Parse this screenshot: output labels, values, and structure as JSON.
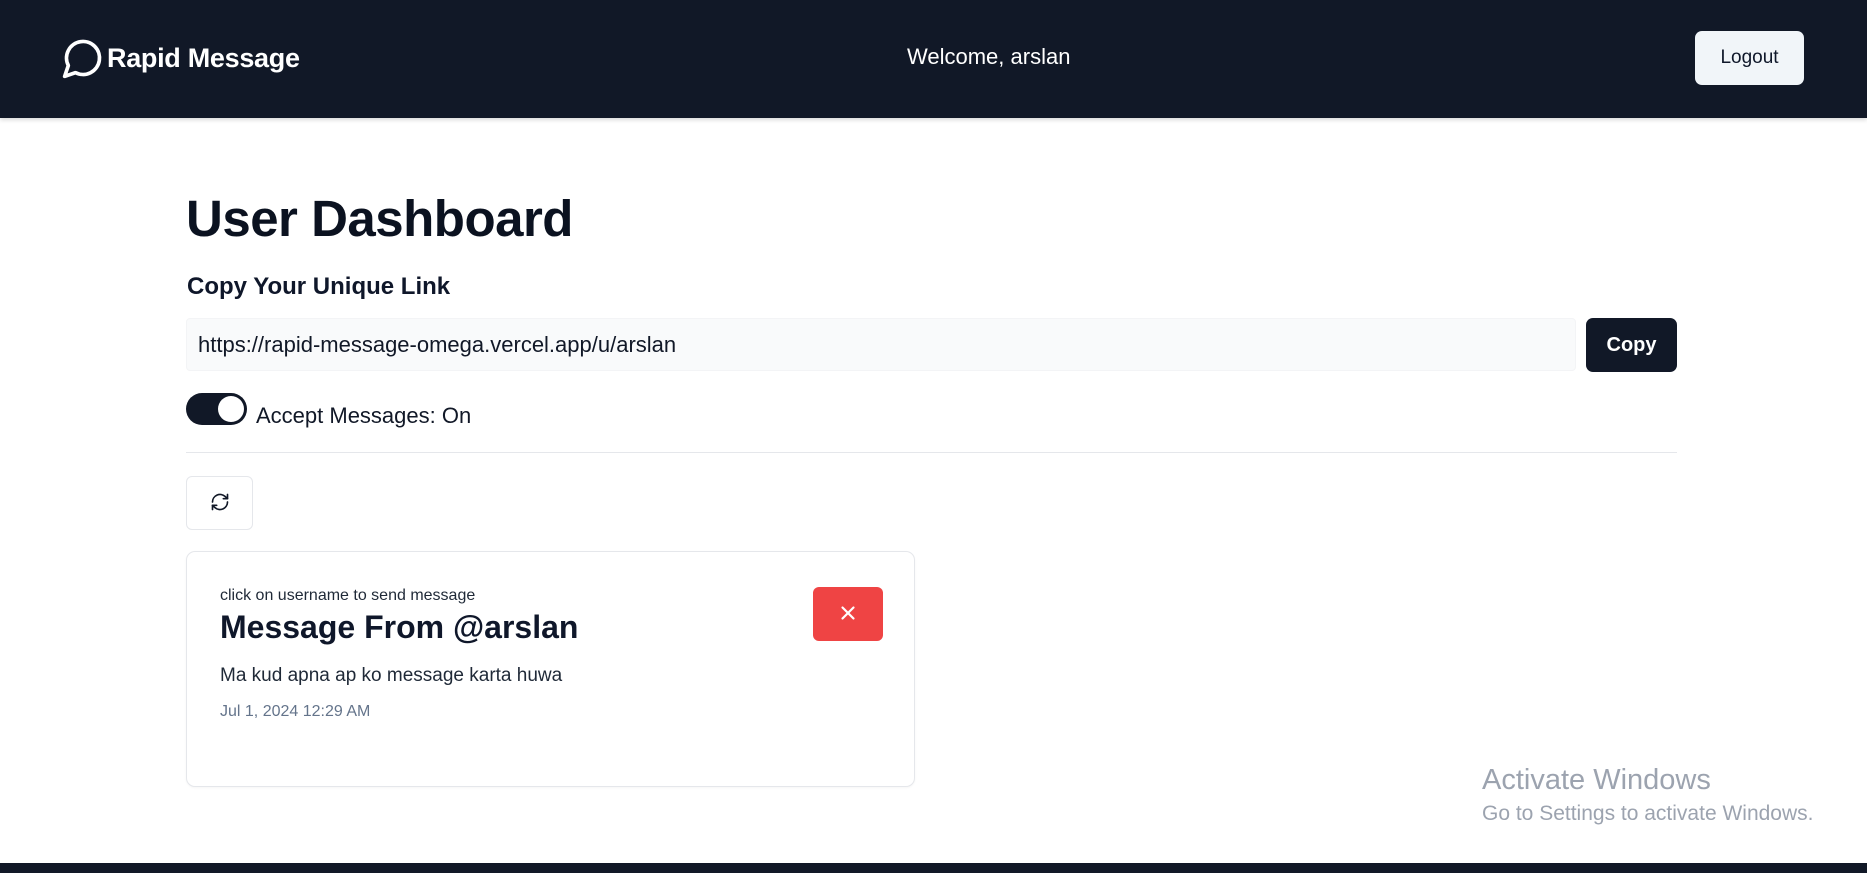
{
  "header": {
    "brand_name": "Rapid Message",
    "brand_icon": "message-circle-icon",
    "welcome_text": "Welcome, arslan",
    "logout_label": "Logout"
  },
  "main": {
    "title": "User Dashboard",
    "link_section_label": "Copy Your Unique Link",
    "unique_link": "https://rapid-message-omega.vercel.app/u/arslan",
    "copy_label": "Copy",
    "accept_messages_label": "Accept Messages: On",
    "accept_messages_on": true,
    "refresh_icon": "refresh-icon"
  },
  "messages": [
    {
      "hint": "click on username to send message",
      "title": "Message From @arslan",
      "content": "Ma kud apna ap ko message karta huwa",
      "date": "Jul 1, 2024 12:29 AM",
      "delete_icon": "close-icon"
    }
  ],
  "watermark": {
    "title": "Activate Windows",
    "subtitle": "Go to Settings to activate Windows."
  },
  "colors": {
    "navbar": "#111827",
    "delete": "#ef4444",
    "accent": "#111827"
  }
}
